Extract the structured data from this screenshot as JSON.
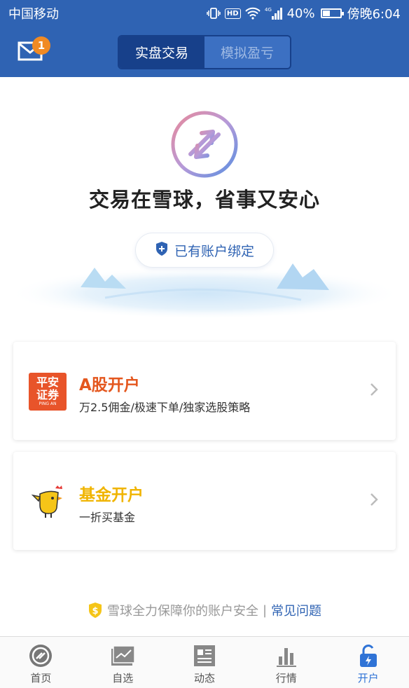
{
  "status_bar": {
    "carrier": "中国移动",
    "network": "4G",
    "hd": "HD",
    "battery": "40%",
    "battery_level": 0.4,
    "time": "傍晚6:04"
  },
  "header": {
    "unread_count": "1",
    "tabs": [
      {
        "label": "实盘交易",
        "active": true
      },
      {
        "label": "模拟盈亏",
        "active": false
      }
    ]
  },
  "hero": {
    "slogan": "交易在雪球，省事又安心",
    "bind_button": "已有账户绑定"
  },
  "cards": [
    {
      "logo_text_top": "平安",
      "logo_text_bottom": "证券",
      "logo_sub": "PING AN",
      "title": "A股开户",
      "title_color": "#e4571e",
      "description": "万2.5佣金/极速下单/独家选股策略"
    },
    {
      "title": "基金开户",
      "title_color": "#f0b400",
      "description": "一折买基金"
    }
  ],
  "security": {
    "text": "雪球全力保障你的账户安全",
    "separator": "|",
    "faq_link": "常见问题"
  },
  "tab_bar": [
    {
      "label": "首页",
      "icon": "snowball-home-icon",
      "active": false
    },
    {
      "label": "自选",
      "icon": "watchlist-chart-icon",
      "active": false
    },
    {
      "label": "动态",
      "icon": "feed-icon",
      "active": false
    },
    {
      "label": "行情",
      "icon": "market-bars-icon",
      "active": false
    },
    {
      "label": "开户",
      "icon": "unlock-icon",
      "active": true
    }
  ],
  "colors": {
    "primary_blue": "#2f63b3",
    "segment_dark": "#17408a",
    "active_tab": "#2f73d6",
    "badge_orange": "#f08a24"
  }
}
